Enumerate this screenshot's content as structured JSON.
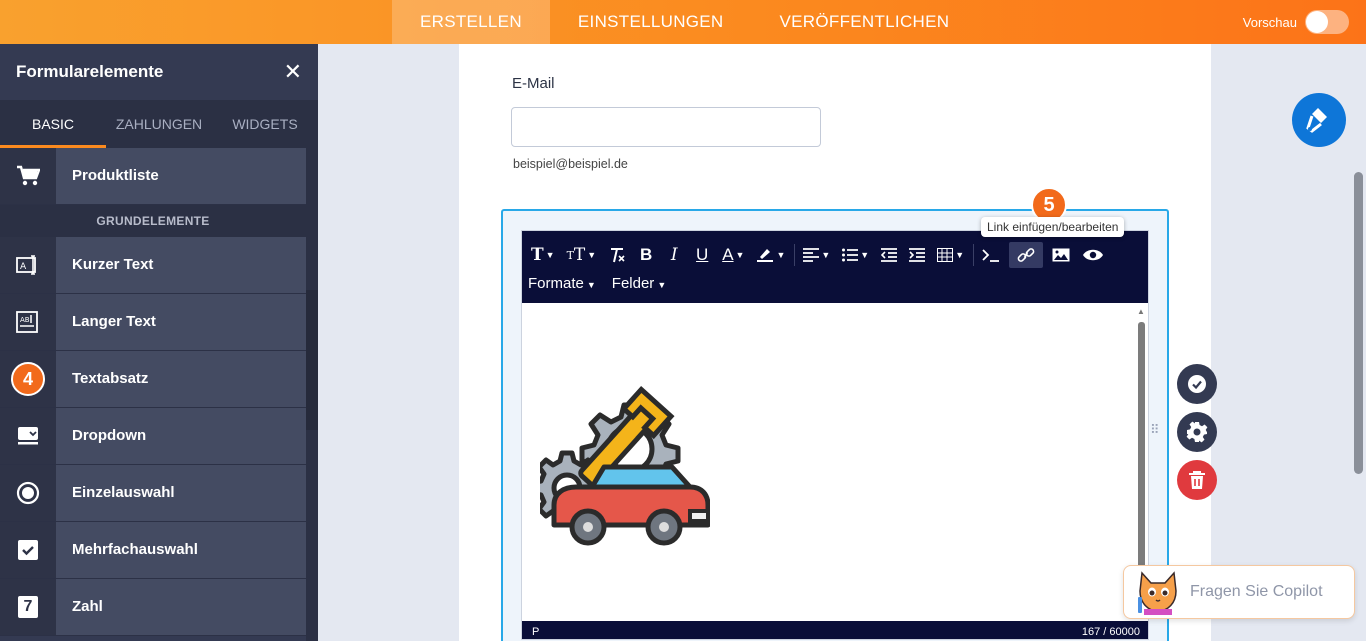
{
  "topbar": {
    "tabs": [
      {
        "label": "ERSTELLEN",
        "active": true
      },
      {
        "label": "EINSTELLUNGEN",
        "active": false
      },
      {
        "label": "VERÖFFENTLICHEN",
        "active": false
      }
    ],
    "preview_label": "Vorschau",
    "preview_enabled": false
  },
  "sidebar": {
    "title": "Formularelemente",
    "tabs": [
      {
        "label": "BASIC",
        "active": true
      },
      {
        "label": "ZAHLUNGEN",
        "active": false
      },
      {
        "label": "WIDGETS",
        "active": false
      }
    ],
    "top_item": {
      "label": "Produktliste",
      "icon": "cart-icon"
    },
    "section_label": "GRUNDELEMENTE",
    "items": [
      {
        "label": "Kurzer Text",
        "icon": "short-text-icon"
      },
      {
        "label": "Langer Text",
        "icon": "long-text-icon"
      },
      {
        "label": "Textabsatz",
        "icon": "paragraph-icon",
        "step_badge": "4"
      },
      {
        "label": "Dropdown",
        "icon": "dropdown-icon"
      },
      {
        "label": "Einzelauswahl",
        "icon": "radio-icon"
      },
      {
        "label": "Mehrfachauswahl",
        "icon": "checkbox-icon"
      },
      {
        "label": "Zahl",
        "icon": "number-icon",
        "icon_text": "7"
      }
    ]
  },
  "form": {
    "email_label": "E-Mail",
    "email_value": "",
    "email_sublabel": "beispiel@beispiel.de"
  },
  "editor": {
    "menus": [
      "Formate",
      "Felder"
    ],
    "tooltip": "Link einfügen/bearbeiten",
    "step_badge": "5",
    "status_path": "P",
    "char_count": "167 / 60000"
  },
  "copilot": {
    "label": "Fragen Sie Copilot"
  },
  "colors": {
    "accent_orange": "#fb8a1f",
    "sidebar_bg": "#343a52",
    "toolbar_bg": "#0a0e38",
    "selection_blue": "#28a8e8",
    "delete_red": "#e03a3e"
  }
}
